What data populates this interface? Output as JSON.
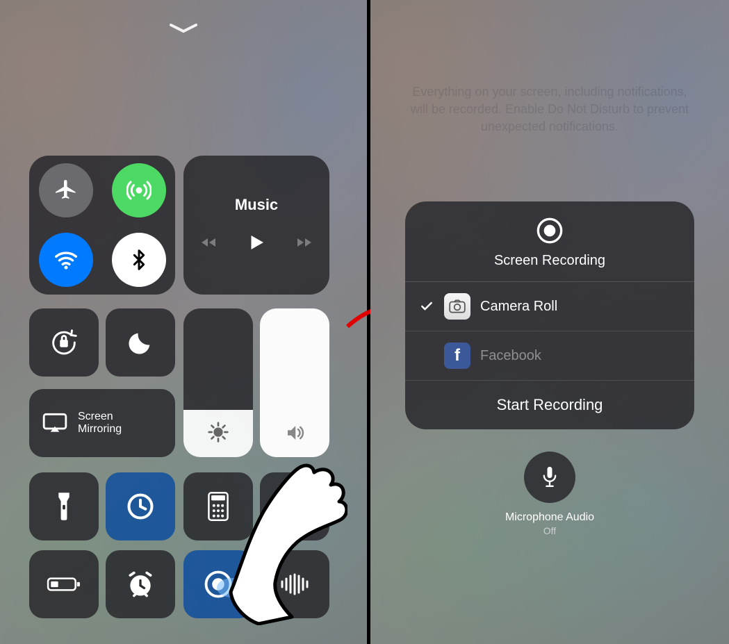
{
  "left": {
    "music": {
      "title": "Music"
    },
    "mirroring": {
      "label_line1": "Screen",
      "label_line2": "Mirroring"
    }
  },
  "right": {
    "faint_text": "Everything on your screen, including notifications, will be recorded. Enable Do Not Disturb to prevent unexpected notifications.",
    "panel": {
      "title": "Screen Recording",
      "options": [
        {
          "label": "Camera Roll",
          "selected": true,
          "icon": "photos"
        },
        {
          "label": "Facebook",
          "selected": false,
          "icon": "facebook"
        }
      ],
      "start_label": "Start Recording"
    },
    "mic": {
      "label": "Microphone Audio",
      "status": "Off"
    }
  }
}
